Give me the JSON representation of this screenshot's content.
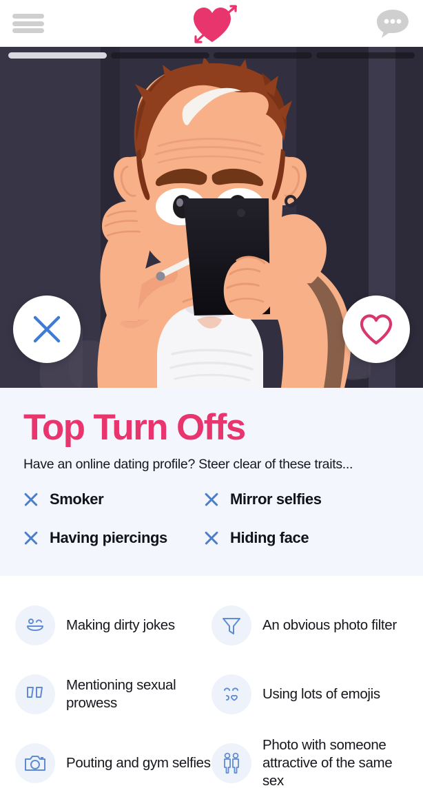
{
  "header": {
    "menu_icon": "hamburger-menu-icon",
    "logo_icon": "heart-with-arrow-logo",
    "messages_icon": "speech-bubble-icon",
    "brand_color": "#e8356d"
  },
  "hero": {
    "progress": {
      "total": 4,
      "active_index": 0
    },
    "illustration": {
      "alt": "Cartoon man flexing bicep taking a mirror selfie with phone covering his face, smoking a cigarette, wearing a white tank top",
      "background_color": "#2e2b3b",
      "skin_color": "#f8b088",
      "hair_color": "#8f3f1d",
      "shirt_color": "#f4f4f6",
      "phone_color": "#141318"
    },
    "actions": {
      "nope_label": "Nope",
      "nope_icon": "close-x-icon",
      "nope_color": "#3f7bd4",
      "like_label": "Like",
      "like_icon": "heart-outline-icon",
      "like_color": "#d9376c"
    }
  },
  "turn_offs": {
    "title": "Top Turn Offs",
    "subtitle": "Have an online dating profile? Steer clear of these traits...",
    "items": [
      {
        "label": "Smoker",
        "icon": "x-icon"
      },
      {
        "label": "Mirror selfies",
        "icon": "x-icon"
      },
      {
        "label": "Having piercings",
        "icon": "x-icon"
      },
      {
        "label": "Hiding face",
        "icon": "x-icon"
      }
    ],
    "background_color": "#f3f6fd",
    "x_color": "#4d7ec9"
  },
  "traits": {
    "background_color": "#ffffff",
    "bubble_color": "#eef2fb",
    "icon_color": "#5f8ad4",
    "items": [
      {
        "label": "Making dirty jokes",
        "icon": "winking-smiley-icon"
      },
      {
        "label": "An obvious photo filter",
        "icon": "funnel-filter-icon"
      },
      {
        "label": "Mentioning sexual prowess",
        "icon": "quotation-marks-icon"
      },
      {
        "label": "Using lots of emojis",
        "icon": "kissing-face-icon"
      },
      {
        "label": "Pouting and gym selfies",
        "icon": "camera-icon"
      },
      {
        "label": "Photo with someone attractive of the same sex",
        "icon": "two-people-icon"
      }
    ]
  }
}
